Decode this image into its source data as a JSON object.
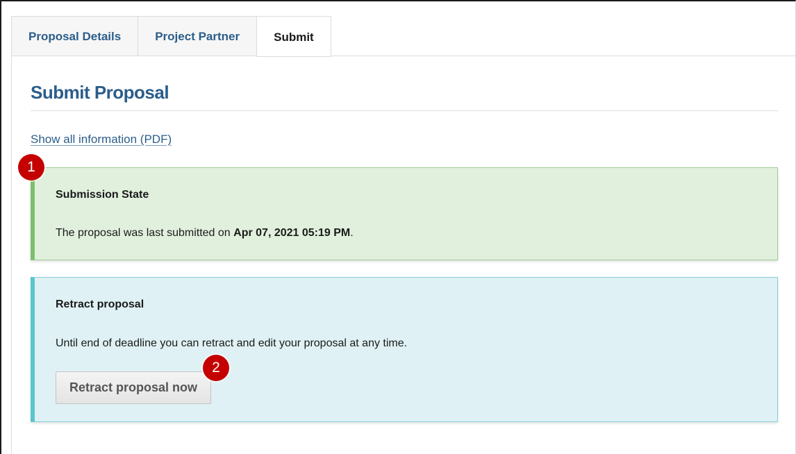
{
  "tabs": [
    {
      "label": "Proposal Details",
      "active": false
    },
    {
      "label": "Project Partner",
      "active": false
    },
    {
      "label": "Submit",
      "active": true
    }
  ],
  "page": {
    "title": "Submit Proposal",
    "pdf_link": "Show all information (PDF)"
  },
  "submission_state": {
    "heading": "Submission State",
    "text_prefix": "The proposal was last submitted on ",
    "date": "Apr 07, 2021 05:19 PM",
    "text_suffix": "."
  },
  "retract": {
    "heading": "Retract proposal",
    "text": "Until end of deadline you can retract and edit your proposal at any time.",
    "button_label": "Retract proposal now"
  },
  "markers": [
    "1",
    "2"
  ],
  "colors": {
    "link_blue": "#2b5d8a",
    "success_bg": "#e1f0dd",
    "success_accent": "#7cbf6d",
    "info_bg": "#dff1f4",
    "info_accent": "#5cc4cc",
    "marker_red": "#c40000"
  }
}
